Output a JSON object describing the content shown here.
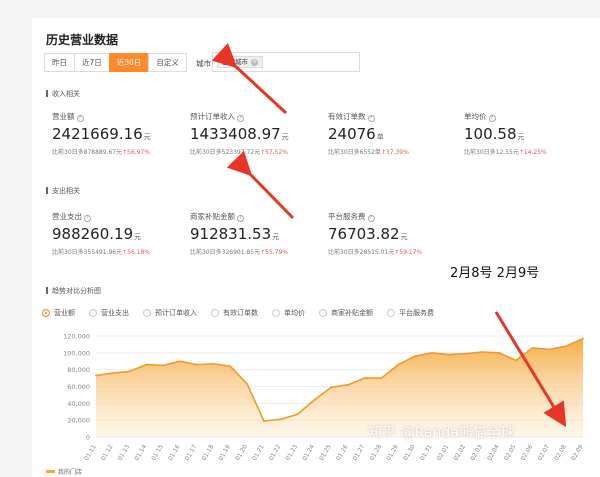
{
  "page": {
    "title": "历史营业数据",
    "tabs": [
      {
        "label": "昨日",
        "active": false
      },
      {
        "label": "近7日",
        "active": false
      },
      {
        "label": "近30日",
        "active": true
      },
      {
        "label": "自定义",
        "active": false
      }
    ],
    "city": {
      "label": "城市",
      "chip": "全部城市"
    }
  },
  "sections": {
    "income": "收入相关",
    "expense": "支出相关",
    "trend": "趋势对比分析图"
  },
  "income_metrics": [
    {
      "name": "营业额",
      "value": "2421669.16",
      "unit": "元",
      "compare": "比前30日多878889.67元",
      "pct": "↑56.97%"
    },
    {
      "name": "预计订单收入",
      "value": "1433408.97",
      "unit": "元",
      "compare": "比前30日多523397.72元",
      "pct": "↑57.52%"
    },
    {
      "name": "有效订单数",
      "value": "24076",
      "unit": "单",
      "compare": "比前30日多6552单",
      "pct": "↑37.39%"
    },
    {
      "name": "单均价",
      "value": "100.58",
      "unit": "元",
      "compare": "比前30日多12.55元",
      "pct": "↑14.25%"
    }
  ],
  "expense_metrics": [
    {
      "name": "营业支出",
      "value": "988260.19",
      "unit": "元",
      "compare": "比前30日多355491.96元",
      "pct": "↑56.18%"
    },
    {
      "name": "商家补贴金额",
      "value": "912831.53",
      "unit": "元",
      "compare": "比前30日多326901.85元",
      "pct": "↑55.79%"
    },
    {
      "name": "平台服务费",
      "value": "76703.82",
      "unit": "元",
      "compare": "比前30日多28515.01元",
      "pct": "↑59.17%"
    }
  ],
  "annotation": "2月8号   2月9号",
  "watermark": "知乎 @Randa熊猫全球",
  "legend_options": [
    {
      "label": "营业额",
      "selected": true
    },
    {
      "label": "营业支出",
      "selected": false
    },
    {
      "label": "预计订单收入",
      "selected": false
    },
    {
      "label": "有效订单数",
      "selected": false
    },
    {
      "label": "单均价",
      "selected": false
    },
    {
      "label": "商家补贴金额",
      "selected": false
    },
    {
      "label": "平台服务费",
      "selected": false
    }
  ],
  "bottom_legend": "我的门店",
  "colors": {
    "accent": "#ff8a2b",
    "area": "#f5a93d",
    "arrow": "#e8352a",
    "up": "#e8565c"
  },
  "chart_data": {
    "type": "area",
    "x": [
      "01.11",
      "01.12",
      "01.13",
      "01.14",
      "01.15",
      "01.16",
      "01.17",
      "01.18",
      "01.19",
      "01.20",
      "01.21",
      "01.22",
      "01.23",
      "01.24",
      "01.25",
      "01.26",
      "01.27",
      "01.28",
      "01.29",
      "01.30",
      "01.31",
      "02.01",
      "02.02",
      "02.03",
      "02.04",
      "02.05",
      "02.06",
      "02.07",
      "02.08",
      "02.09"
    ],
    "series": [
      {
        "values": [
          73000,
          76000,
          78000,
          86000,
          85000,
          90000,
          86000,
          87000,
          84000,
          63000,
          19000,
          21000,
          27000,
          44000,
          59000,
          62000,
          70000,
          70000,
          86000,
          96000,
          100000,
          98000,
          99000,
          101000,
          100000,
          91000,
          106000,
          104000,
          108000,
          117000
        ]
      }
    ],
    "y_ticks": [
      0,
      20000,
      40000,
      60000,
      80000,
      100000,
      120000
    ],
    "y_tick_labels": [
      "0",
      "20,000",
      "40,000",
      "60,000",
      "80,000",
      "100,000",
      "120,000"
    ],
    "ylim": [
      0,
      120000
    ],
    "grid": true
  }
}
